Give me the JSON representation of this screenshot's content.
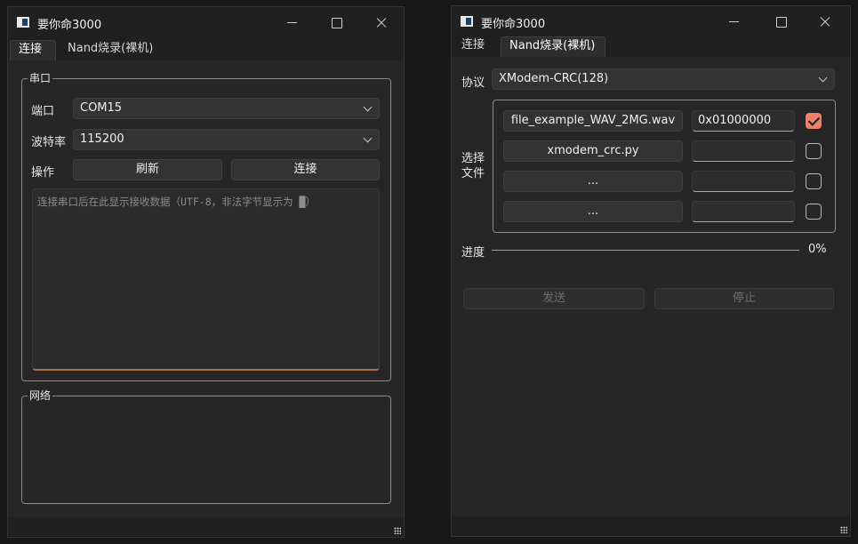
{
  "windows": {
    "left": {
      "title": "要你命3000",
      "tabs": [
        {
          "label": "连接",
          "active": true
        },
        {
          "label": "Nand烧录(裸机)",
          "active": false
        }
      ],
      "serial": {
        "group_title": "串口",
        "port_label": "端口",
        "port_value": "COM15",
        "baud_label": "波特率",
        "baud_value": "115200",
        "action_label": "操作",
        "refresh_label": "刷新",
        "connect_label": "连接",
        "receive_placeholder": "连接串口后在此显示接收数据（UTF-8，非法字节显示为 █）"
      },
      "network": {
        "group_title": "网络"
      }
    },
    "right": {
      "title": "要你命3000",
      "tabs": [
        {
          "label": "连接",
          "active": false
        },
        {
          "label": "Nand烧录(裸机)",
          "active": true
        }
      ],
      "protocol_label": "协议",
      "protocol_value": "XModem-CRC(128)",
      "select_file_label": "选择\n文件",
      "files": [
        {
          "file": "file_example_WAV_2MG.wav",
          "address": "0x01000000",
          "checked": true
        },
        {
          "file": "xmodem_crc.py",
          "address": "",
          "checked": false
        },
        {
          "file": "...",
          "address": "",
          "checked": false
        },
        {
          "file": "...",
          "address": "",
          "checked": false
        }
      ],
      "progress_label": "进度",
      "progress_value": "0%",
      "progress": 0,
      "send_label": "发送",
      "stop_label": "停止"
    }
  },
  "colors": {
    "accent": "#ec8068",
    "window_bg": "#262626",
    "titlebar_bg": "#202020",
    "focus_underline": "#b56a4a"
  },
  "icons": [
    "app-icon",
    "minimize-icon",
    "maximize-icon",
    "close-icon",
    "chevron-down-icon",
    "checkmark-icon",
    "resize-grip-icon"
  ]
}
